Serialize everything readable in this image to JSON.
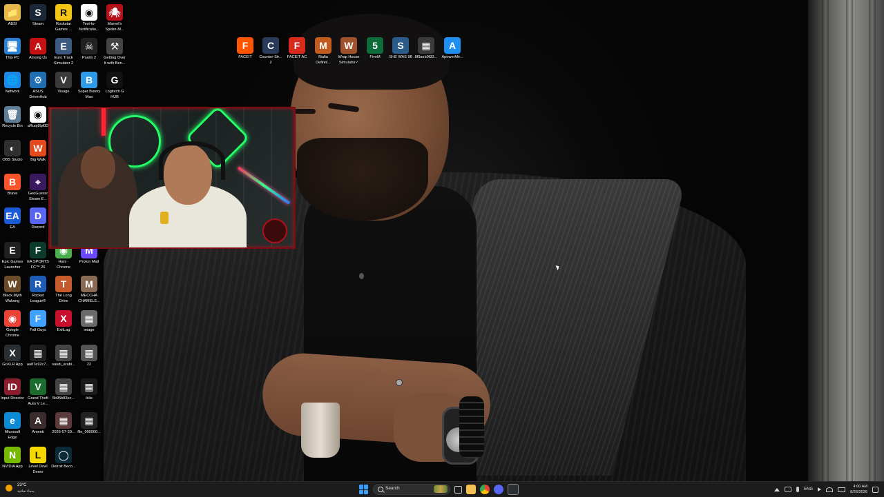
{
  "desktop": {
    "icons": [
      {
        "label": "ABSI",
        "glyph": "📁",
        "color": "#e6b84a"
      },
      {
        "label": "Steam",
        "glyph": "S",
        "color": "#1b2838"
      },
      {
        "label": "Rockstar Games ...",
        "glyph": "R",
        "color": "#f4c415"
      },
      {
        "label": "Text-to-Notificatio...",
        "glyph": "◉",
        "color": "#ffffff"
      },
      {
        "label": "Marvel's Spider-M...",
        "glyph": "🕷",
        "color": "#b3101a"
      },
      {
        "label": "This PC",
        "glyph": "🖥",
        "color": "#2b7fd0"
      },
      {
        "label": "Among Us",
        "glyph": "A",
        "color": "#c51111"
      },
      {
        "label": "Euro Truck Simulator 2",
        "glyph": "E",
        "color": "#3d5a80"
      },
      {
        "label": "Psalm 2",
        "glyph": "☠",
        "color": "#222222"
      },
      {
        "label": "Getting Over It with Ben...",
        "glyph": "⚒",
        "color": "#444444"
      },
      {
        "label": "Network",
        "glyph": "🌐",
        "color": "#1e88e5"
      },
      {
        "label": "ASUS DriverHub",
        "glyph": "⚙",
        "color": "#1f6fb2"
      },
      {
        "label": "Visage",
        "glyph": "V",
        "color": "#3a3a3a"
      },
      {
        "label": "Super Bunny Man",
        "glyph": "B",
        "color": "#2f9be8"
      },
      {
        "label": "Logitech G HUB",
        "glyph": "G",
        "color": "#111111"
      },
      {
        "label": "Recycle Bin",
        "glyph": "🗑",
        "color": "#5f7d95"
      },
      {
        "label": "aRuoj8lpl0D",
        "glyph": "◉",
        "color": "#ffffff"
      },
      {
        "label": "OBS Studio",
        "glyph": "◐",
        "color": "#302e31"
      },
      {
        "label": "Big Walk",
        "glyph": "W",
        "color": "#e34b1c"
      },
      {
        "label": "Brave",
        "glyph": "B",
        "color": "#fb542b"
      },
      {
        "label": "GeoGuessr Steam E...",
        "glyph": "⌖",
        "color": "#3a1a5f"
      },
      {
        "label": "EA",
        "glyph": "EA",
        "color": "#1b5ad6"
      },
      {
        "label": "Discord",
        "glyph": "D",
        "color": "#5865f2"
      },
      {
        "label": "Epic Games Launcher",
        "glyph": "E",
        "color": "#202020"
      },
      {
        "label": "EA SPORTS FC™ 26",
        "glyph": "F",
        "color": "#0c3b2e"
      },
      {
        "label": "Hani - Chrome",
        "glyph": "◉",
        "color": "#4caf50"
      },
      {
        "label": "Proton Mail",
        "glyph": "M",
        "color": "#6d4aff"
      },
      {
        "label": "Black Myth Wukong",
        "glyph": "W",
        "color": "#6b4a2a"
      },
      {
        "label": "Rocket League®",
        "glyph": "R",
        "color": "#1e5bb5"
      },
      {
        "label": "The Long Drive",
        "glyph": "T",
        "color": "#c55a2a"
      },
      {
        "label": "MECCHA CHAMELE...",
        "glyph": "M",
        "color": "#8a6a55"
      },
      {
        "label": "Google Chrome",
        "glyph": "◉",
        "color": "#ea4335"
      },
      {
        "label": "Fall Guys",
        "glyph": "F",
        "color": "#3da3ff"
      },
      {
        "label": "ExitLag",
        "glyph": "X",
        "color": "#c8102e"
      },
      {
        "label": "image",
        "glyph": "▦",
        "color": "#6a6a6a"
      },
      {
        "label": "GoXLR App",
        "glyph": "X",
        "color": "#2a2f33"
      },
      {
        "label": "aa87e92c7...",
        "glyph": "▦",
        "color": "#202020"
      },
      {
        "label": "saudi_arabi...",
        "glyph": "▦",
        "color": "#444444"
      },
      {
        "label": "22",
        "glyph": "▦",
        "color": "#555555"
      },
      {
        "label": "Input Director",
        "glyph": "ID",
        "color": "#8a1d2b"
      },
      {
        "label": "Grand Theft Auto V Le...",
        "glyph": "V",
        "color": "#1b6b2f"
      },
      {
        "label": "5b95b83ec...",
        "glyph": "▦",
        "color": "#444444"
      },
      {
        "label": "iblis",
        "glyph": "▦",
        "color": "#1a1a1a"
      },
      {
        "label": "Microsoft Edge",
        "glyph": "e",
        "color": "#0c8ad6"
      },
      {
        "label": "Amenti",
        "glyph": "A",
        "color": "#3b2c2c"
      },
      {
        "label": "2026-07-20...",
        "glyph": "▦",
        "color": "#5a3a3a"
      },
      {
        "label": "file_000000...",
        "glyph": "▦",
        "color": "#222222"
      },
      {
        "label": "NVIDIA App",
        "glyph": "N",
        "color": "#76b900"
      },
      {
        "label": "Level Devil Demo",
        "glyph": "L",
        "color": "#f5d800"
      },
      {
        "label": "Detroit Beco...",
        "glyph": "◯",
        "color": "#0a2a3a"
      },
      {
        "label": "FACEIT",
        "glyph": "F",
        "color": "#ff5500"
      },
      {
        "label": "Counter-Str... 2",
        "glyph": "C",
        "color": "#2a3b5a"
      },
      {
        "label": "FACEIT AC",
        "glyph": "F",
        "color": "#d92b1d"
      },
      {
        "label": "Mafia Definiti...",
        "glyph": "M",
        "color": "#c25b1e"
      },
      {
        "label": "Wrap House Simulator✓",
        "glyph": "W",
        "color": "#a0522d"
      },
      {
        "label": "FiveM",
        "glyph": "5",
        "color": "#0e6b3a"
      },
      {
        "label": "SHE WAS 98",
        "glyph": "S",
        "color": "#2a5b8a"
      },
      {
        "label": "8f9aeb9f33...",
        "glyph": "▦",
        "color": "#3a3a3a"
      },
      {
        "label": "ApowerMir...",
        "glyph": "A",
        "color": "#1e8ef0"
      }
    ]
  },
  "taskbar": {
    "weather_temp": "23°C",
    "weather_condition": "سماء صافية",
    "search_placeholder": "Search",
    "language": "ENG",
    "time": "4:00 AM",
    "date": "8/26/2026"
  },
  "colors": {
    "taskbar_bg": "#1c1c1c",
    "start_blue": "#3aa0ff",
    "webcam_border": "#7a0c12"
  }
}
